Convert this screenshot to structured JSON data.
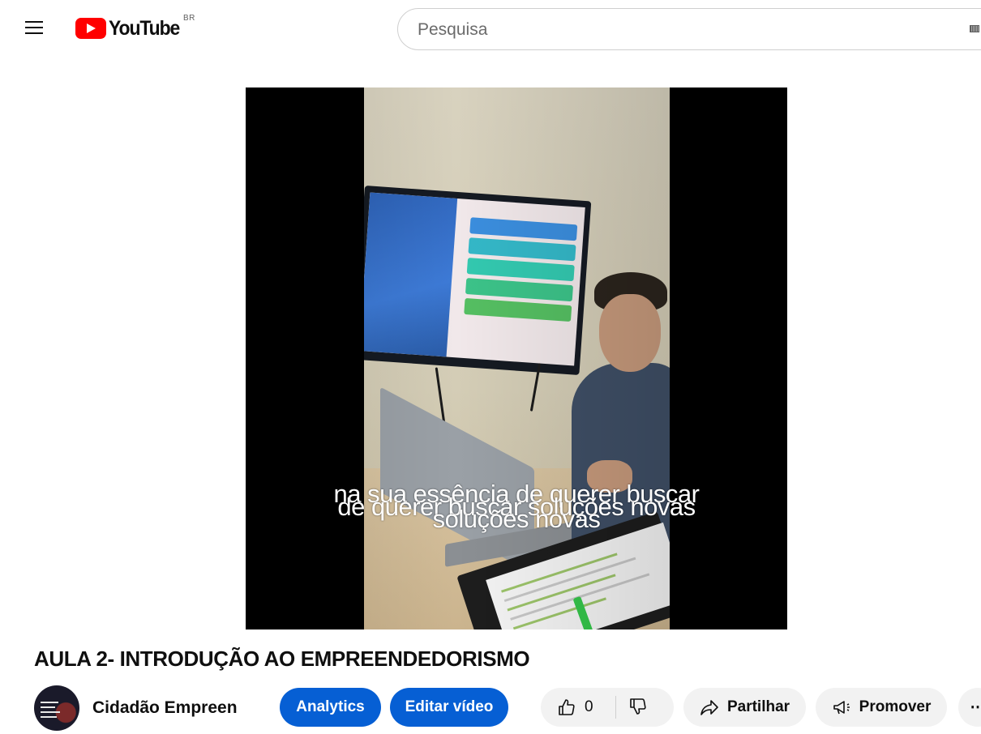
{
  "masthead": {
    "logo_text": "YouTube",
    "country_code": "BR",
    "search_placeholder": "Pesquisa"
  },
  "player": {
    "captions": {
      "line_a": "na sua essência de querer buscar",
      "line_b": "de querer buscar soluções novas",
      "line_c": "soluções novas"
    }
  },
  "video": {
    "title": "AULA 2- INTRODUÇÃO AO EMPREENDEDORISMO"
  },
  "channel": {
    "name": "Cidadão Empreen"
  },
  "actions": {
    "analytics_label": "Analytics",
    "edit_label": "Editar vídeo",
    "like_count": "0",
    "share_label": "Partilhar",
    "promote_label": "Promover",
    "more_label": "⋯"
  },
  "colors": {
    "brand_red": "#ff0000",
    "primary_blue": "#065fd4",
    "pill_gray": "#f2f2f2"
  }
}
